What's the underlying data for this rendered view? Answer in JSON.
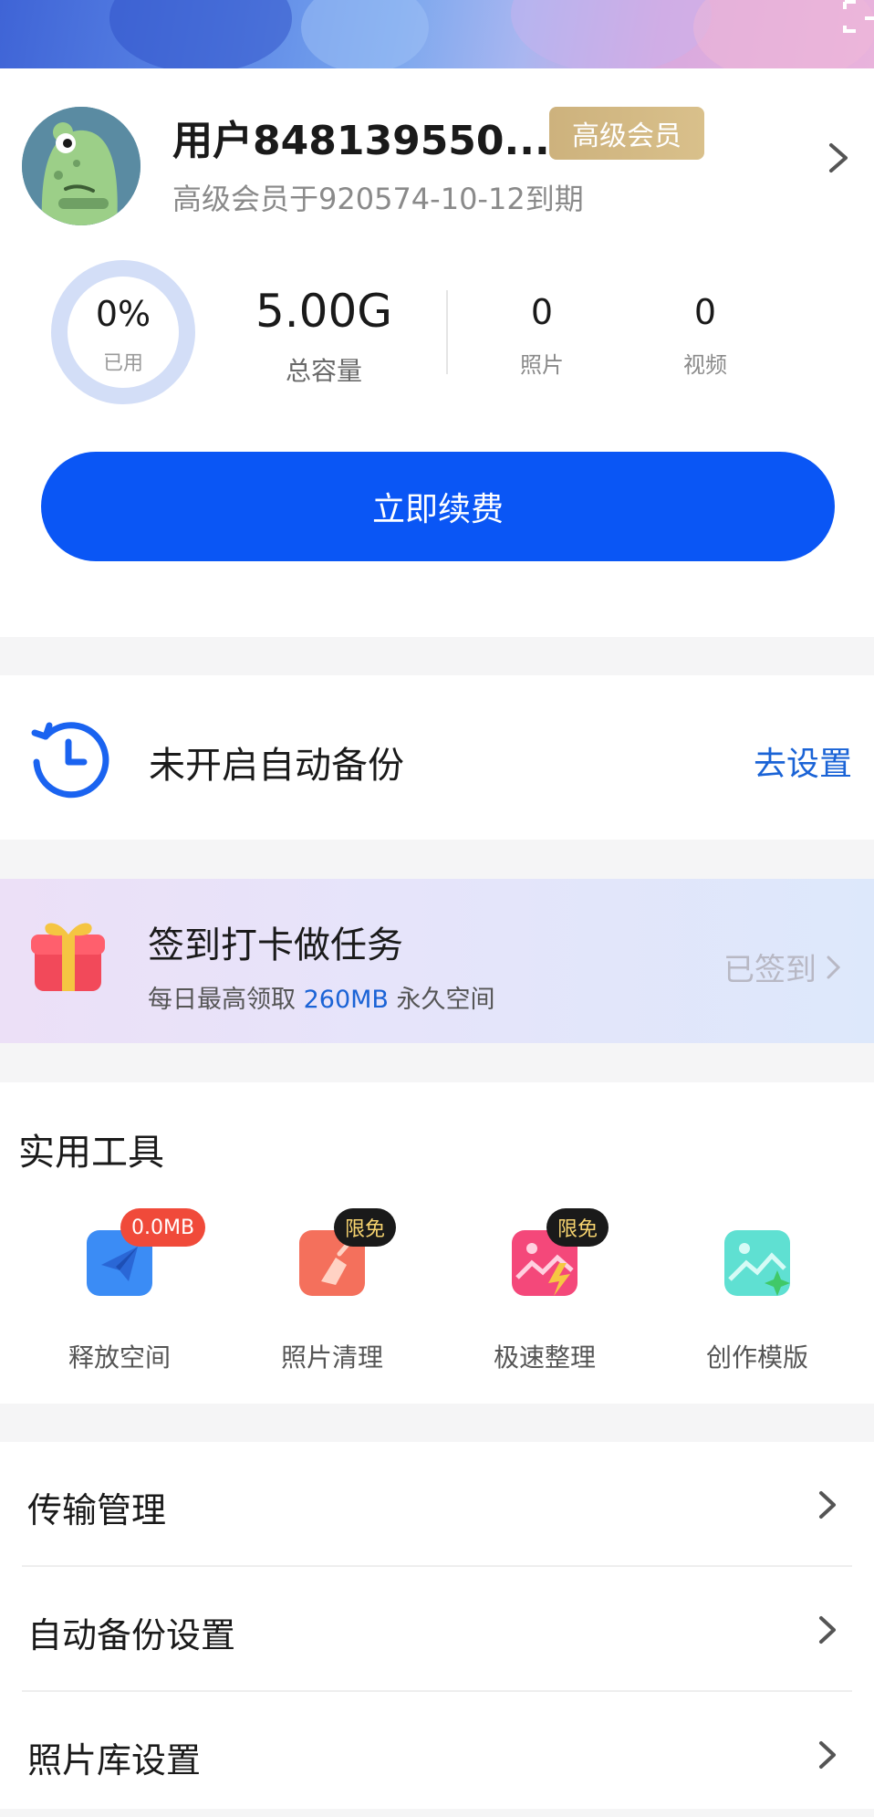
{
  "profile": {
    "username": "用户848139550...",
    "vip_badge": "高级会员",
    "expire_text": "高级会员于920574-10-12到期"
  },
  "storage": {
    "used_percent_text": "0%",
    "used_label": "已用",
    "used_fraction": 0,
    "capacity_value": "5.00G",
    "capacity_label": "总容量",
    "photos_value": "0",
    "photos_label": "照片",
    "videos_value": "0",
    "videos_label": "视频"
  },
  "renew_button": "立即续费",
  "backup": {
    "status_text": "未开启自动备份",
    "link_text": "去设置",
    "icon": "backup-clock-icon"
  },
  "sign_in": {
    "title": "签到打卡做任务",
    "subtitle_prefix": "每日最高领取",
    "subtitle_highlight": "260MB",
    "subtitle_suffix": "永久空间",
    "status": "已签到",
    "icon": "gift-icon"
  },
  "tools": {
    "title": "实用工具",
    "items": [
      {
        "label": "释放空间",
        "badge": "0.0MB",
        "icon": "paper-plane-icon"
      },
      {
        "label": "照片清理",
        "badge": "限免",
        "icon": "broom-icon"
      },
      {
        "label": "极速整理",
        "badge": "限免",
        "icon": "lightning-image-icon"
      },
      {
        "label": "创作模版",
        "badge": "",
        "icon": "sparkle-image-icon"
      }
    ]
  },
  "settings": {
    "items": [
      {
        "label": "传输管理"
      },
      {
        "label": "自动备份设置"
      },
      {
        "label": "照片库设置"
      }
    ]
  },
  "colors": {
    "accent": "#0a56f5",
    "link": "#1a63d6",
    "vip_gold": "#cdb27d",
    "badge_red": "#f04a3a"
  }
}
